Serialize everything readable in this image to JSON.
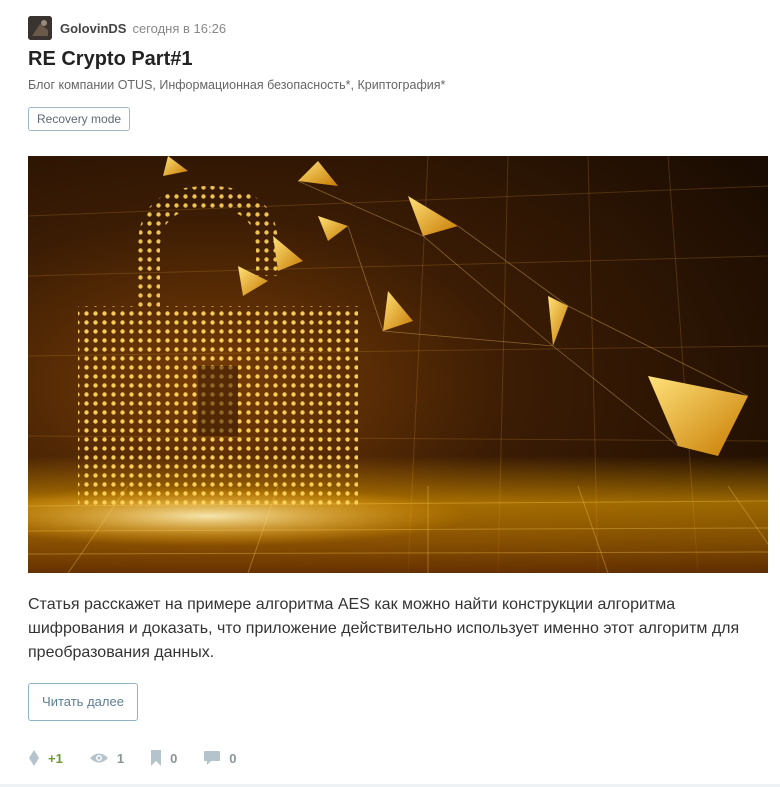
{
  "post": {
    "author": "GolovinDS",
    "date": "сегодня в 16:26",
    "title": "RE Crypto Part#1",
    "hubs": [
      "Блог компании OTUS",
      "Информационная безопасность*",
      "Криптография*"
    ],
    "badge": "Recovery mode",
    "lead": "Статья расскажет на примере алгоритма AES как можно найти конструкции алгоритма шифрования и доказать, что приложение действительно использует именно этот алгоритм для преобразования данных.",
    "read_more": "Читать далее"
  },
  "stats": {
    "score": "+1",
    "views": "1",
    "bookmarks": "0",
    "comments": "0"
  },
  "colors": {
    "accent": "#8fb3c7",
    "score": "#6c9a35",
    "hero_gold": "#f0a800"
  },
  "icons": [
    "avatar-image",
    "score-icon",
    "eye-icon",
    "bookmark-icon",
    "comment-icon"
  ]
}
